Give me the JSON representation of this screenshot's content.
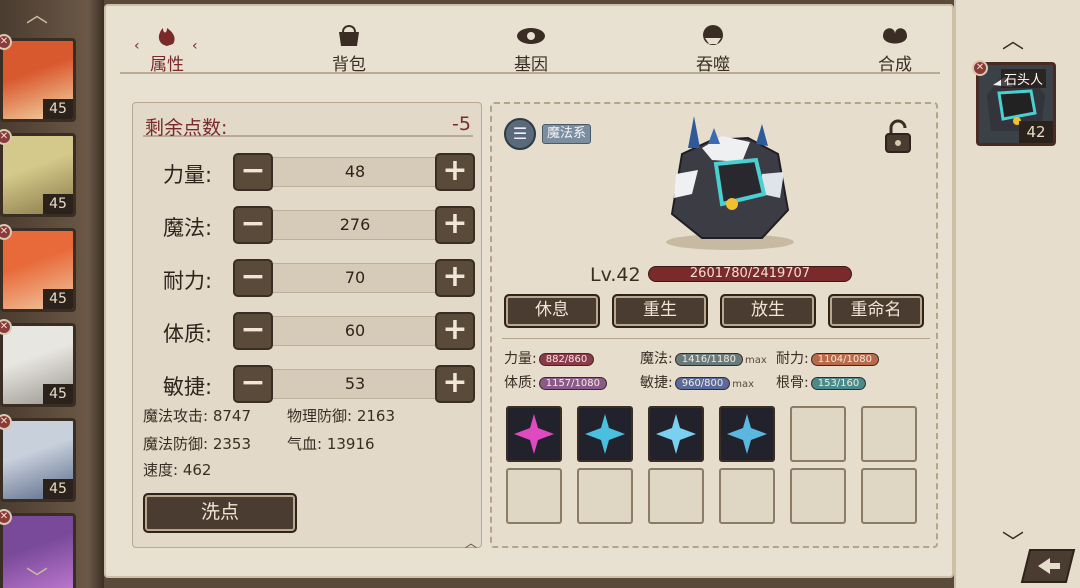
{
  "roster": [
    {
      "level": "45",
      "colors": [
        "#d9592e",
        "#f3d7a8"
      ]
    },
    {
      "level": "45",
      "colors": [
        "#d4c98a",
        "#8a7a4a"
      ]
    },
    {
      "level": "45",
      "colors": [
        "#e86a3a",
        "#f0c8a0"
      ]
    },
    {
      "level": "45",
      "colors": [
        "#e8e6e0",
        "#9a9690"
      ]
    },
    {
      "level": "45",
      "colors": [
        "#c8d0dc",
        "#5a6a88"
      ]
    },
    {
      "level": "",
      "colors": [
        "#7a4a9a",
        "#c07ad0"
      ]
    }
  ],
  "tabs": [
    {
      "label": "属性",
      "icon": "flame-icon",
      "active": true
    },
    {
      "label": "背包",
      "icon": "bag-icon",
      "active": false
    },
    {
      "label": "基因",
      "icon": "eye-icon",
      "active": false
    },
    {
      "label": "吞噬",
      "icon": "devour-icon",
      "active": false
    },
    {
      "label": "合成",
      "icon": "fuse-icon",
      "active": false
    }
  ],
  "attributes": {
    "remaining_label": "剩余点数:",
    "remaining_value": "-5",
    "stats": [
      {
        "label": "力量:",
        "value": "48"
      },
      {
        "label": "魔法:",
        "value": "276"
      },
      {
        "label": "耐力:",
        "value": "70"
      },
      {
        "label": "体质:",
        "value": "60"
      },
      {
        "label": "敏捷:",
        "value": "53"
      }
    ],
    "derived": {
      "magic_attack": "魔法攻击: 8747",
      "physical_defense": "物理防御: 2163",
      "magic_defense": "魔法防御: 2353",
      "hp": "气血: 13916",
      "speed": "速度: 462"
    },
    "wash_label": "洗点"
  },
  "pet": {
    "type_label": "魔法系",
    "level": "Lv.42",
    "hp": "2601780/2419707",
    "actions": [
      "休息",
      "重生",
      "放生",
      "重命名"
    ],
    "aptitudes": [
      {
        "label": "力量:",
        "value": "882/860",
        "color": "#8a3a4a",
        "max": ""
      },
      {
        "label": "魔法:",
        "value": "1416/1180",
        "color": "#6a7a7a",
        "max": "max"
      },
      {
        "label": "耐力:",
        "value": "1104/1080",
        "color": "#b86a4a",
        "max": ""
      },
      {
        "label": "体质:",
        "value": "1157/1080",
        "color": "#8a5a8a",
        "max": ""
      },
      {
        "label": "敏捷:",
        "value": "960/800",
        "color": "#5a6a9a",
        "max": "max"
      },
      {
        "label": "根骨:",
        "value": "153/160",
        "color": "#4a8a8a",
        "max": ""
      }
    ],
    "skills": [
      {
        "icon": "pink-starburst-icon",
        "color": "#e04ac0"
      },
      {
        "icon": "ice-spikes-icon",
        "color": "#4ac0e0"
      },
      {
        "icon": "ice-giant-icon",
        "color": "#7ad0f0"
      },
      {
        "icon": "ice-shield-icon",
        "color": "#5ab8e0"
      }
    ],
    "empty_slots": 8
  },
  "selected": {
    "name": "石头人",
    "level": "42"
  }
}
